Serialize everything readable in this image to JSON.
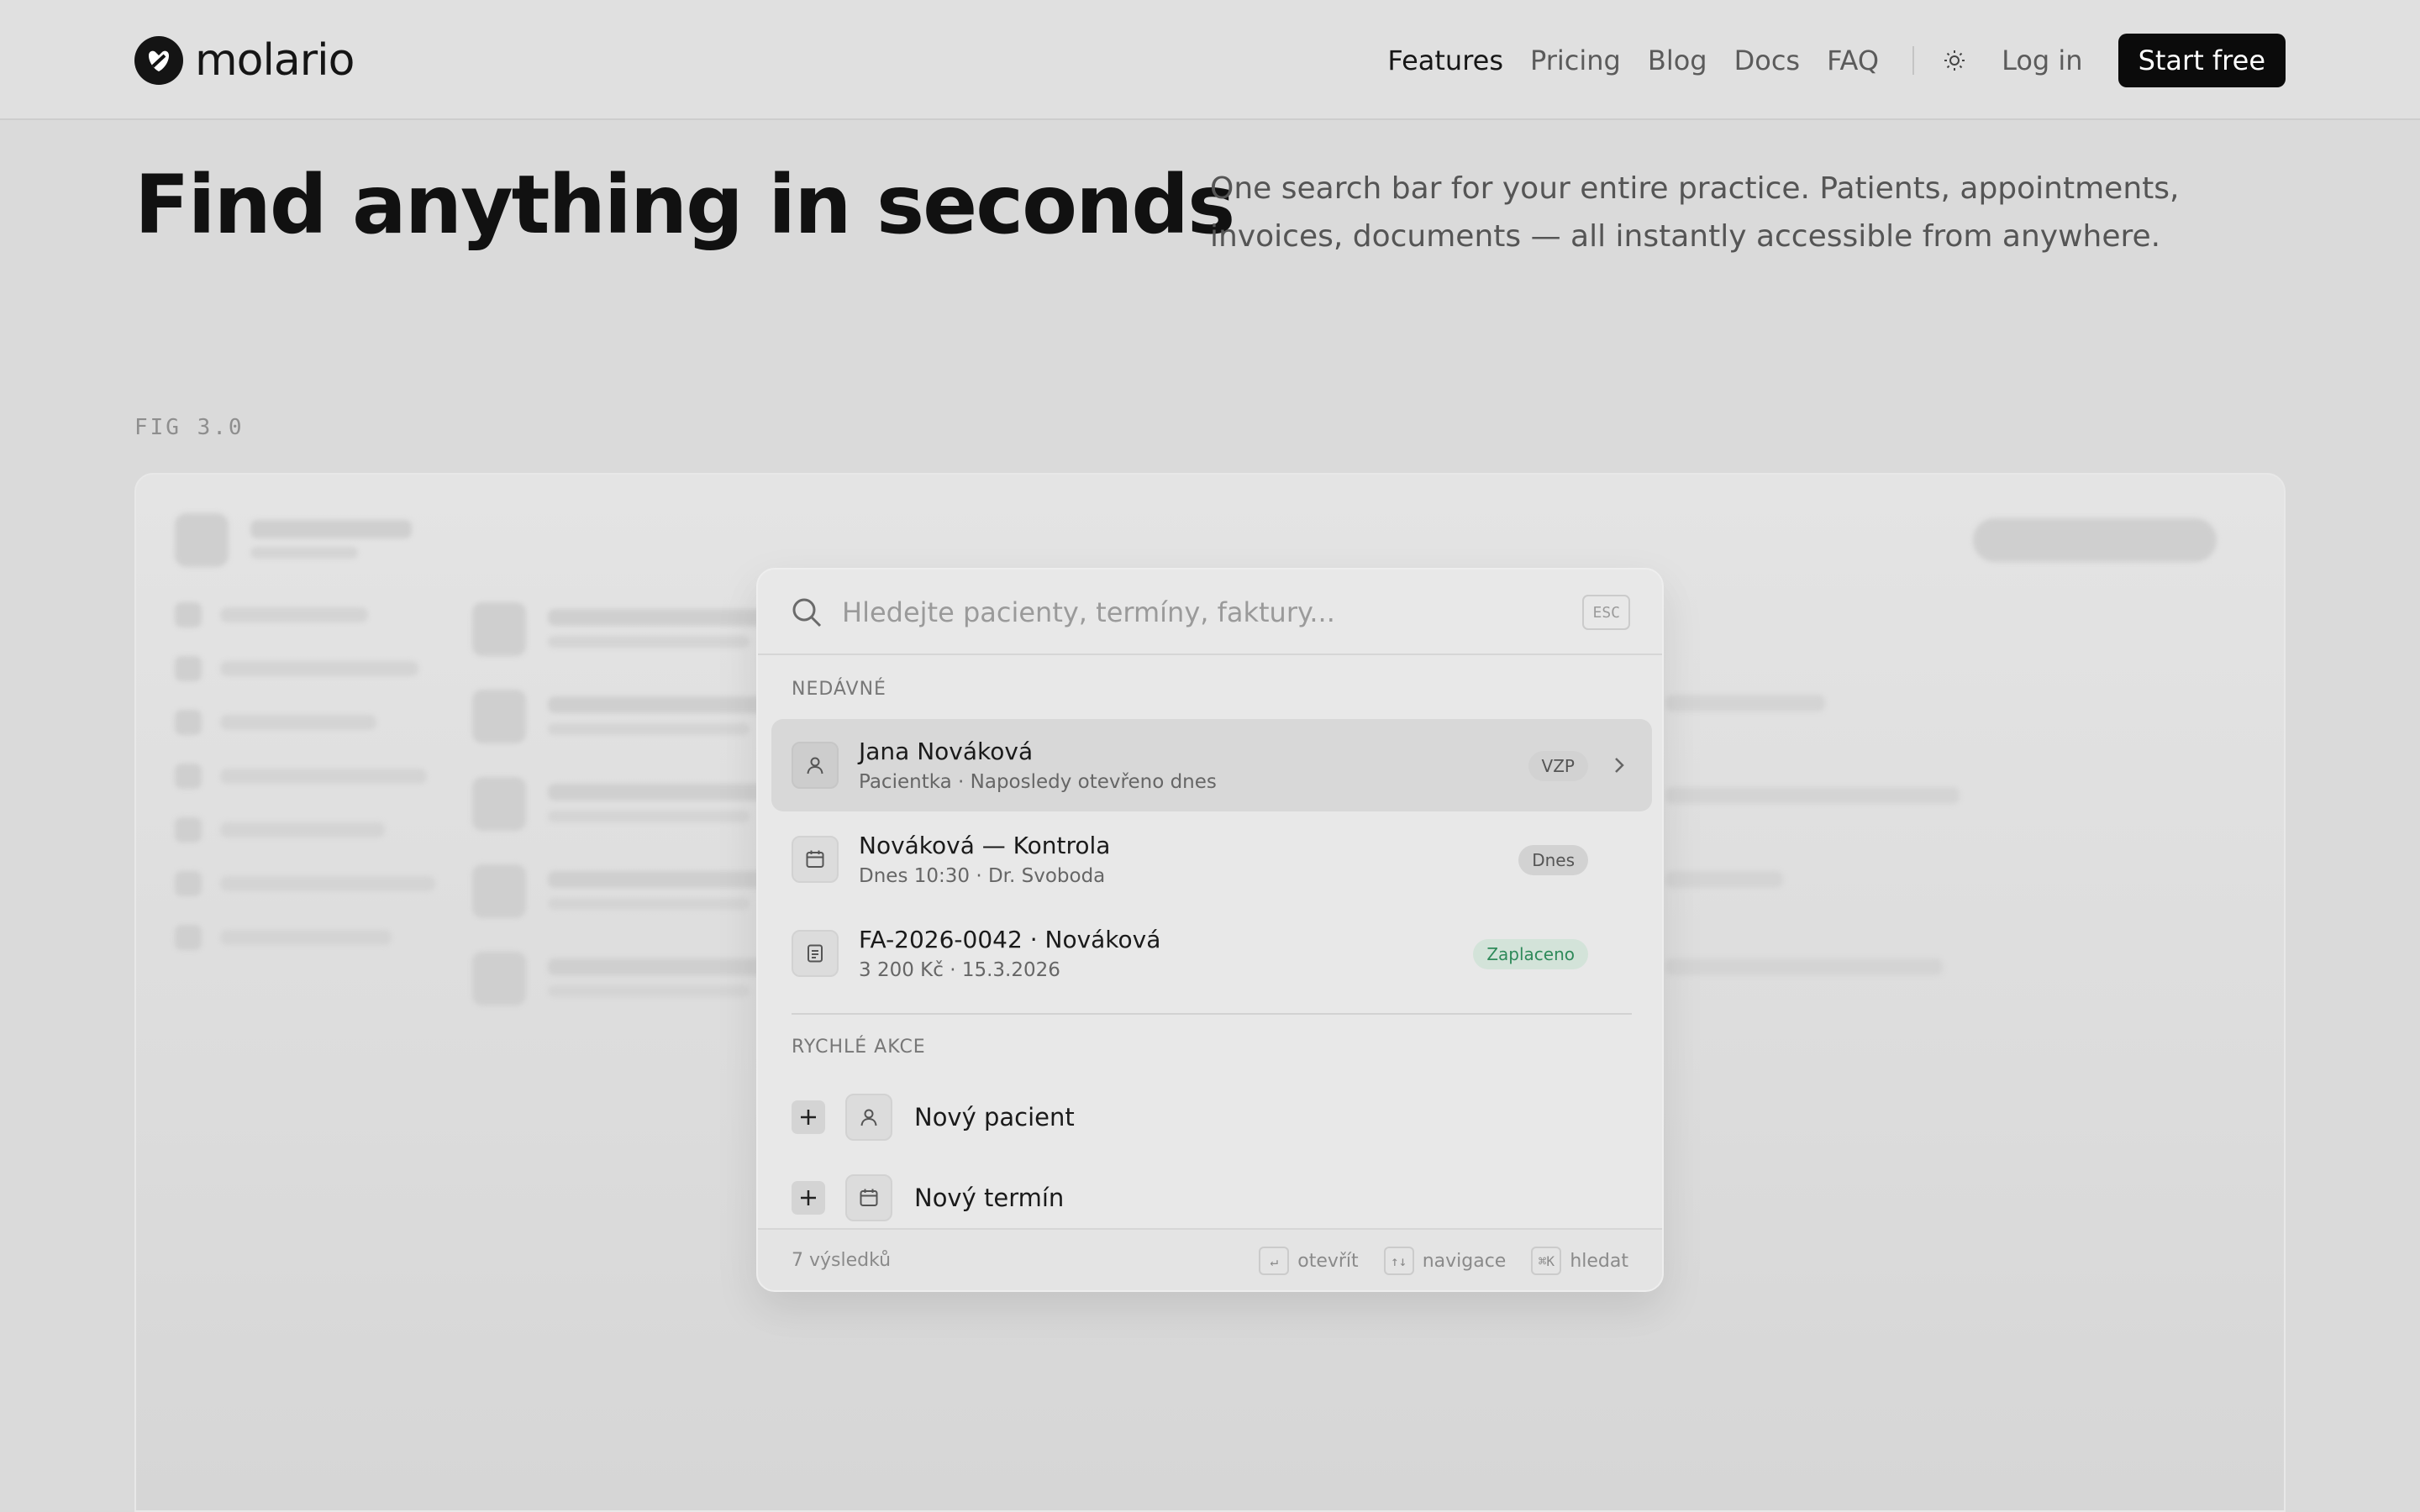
{
  "nav": {
    "brand": "molario",
    "links": [
      "Features",
      "Pricing",
      "Blog",
      "Docs",
      "FAQ"
    ],
    "active_link": "Features",
    "login": "Log in",
    "cta": "Start free"
  },
  "hero": {
    "title": "Find anything in seconds",
    "subtitle": "One search bar for your entire practice. Patients, appointments, invoices, documents — all instantly accessible from anywhere."
  },
  "figure": {
    "label": "FIG 3.0"
  },
  "palette": {
    "search_placeholder": "Hledejte pacienty, termíny, faktury...",
    "esc": "ESC",
    "recent_title": "NEDÁVNÉ",
    "recent": [
      {
        "title": "Jana Nováková",
        "subtitle": "Pacientka · Naposledy otevřeno dnes",
        "badge": "VZP",
        "icon": "user-icon"
      },
      {
        "title": "Nováková — Kontrola",
        "subtitle": "Dnes 10:30 · Dr. Svoboda",
        "badge": "Dnes",
        "icon": "calendar-icon"
      },
      {
        "title": "FA-2026-0042 · Nováková",
        "subtitle": "3 200 Kč · 15.3.2026",
        "badge": "Zaplaceno",
        "icon": "invoice-icon"
      }
    ],
    "actions_title": "RYCHLÉ AKCE",
    "actions": [
      {
        "label": "Nový pacient",
        "icon": "user-icon"
      },
      {
        "label": "Nový termín",
        "icon": "calendar-icon"
      }
    ],
    "footer": {
      "count": "7 výsledků",
      "hints": [
        {
          "key": "↵",
          "label": "otevřít"
        },
        {
          "key": "↑↓",
          "label": "navigace"
        },
        {
          "key": "⌘K",
          "label": "hledat"
        }
      ]
    }
  },
  "colors": {
    "accent": "#0b0b0b",
    "paid_badge_bg": "#d3e3d9",
    "paid_badge_text": "#2f8a5a"
  }
}
